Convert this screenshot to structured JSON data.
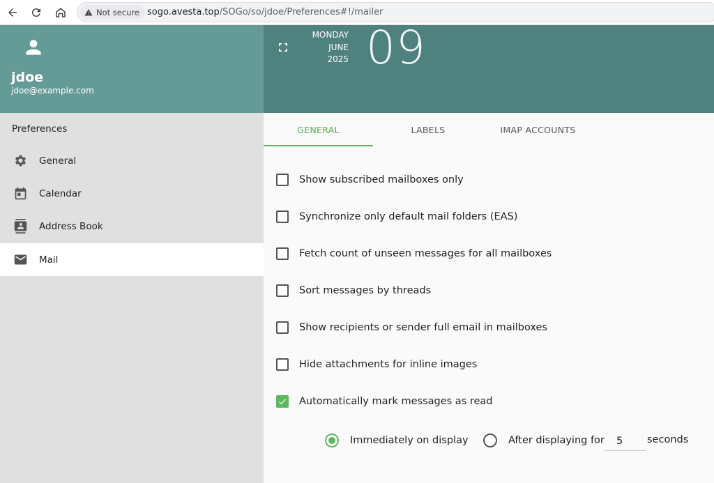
{
  "browser": {
    "security_label": "Not secure",
    "url_host": "sogo.avesta.top",
    "url_path": "/SOGo/so/jdoe/Preferences#!/mailer"
  },
  "user": {
    "name": "jdoe",
    "email": "jdoe@example.com"
  },
  "date": {
    "weekday": "MONDAY",
    "month": "JUNE",
    "year": "2025",
    "day": "09"
  },
  "sidebar": {
    "title": "Preferences",
    "items": [
      {
        "label": "General",
        "icon": "gear-icon"
      },
      {
        "label": "Calendar",
        "icon": "calendar-icon"
      },
      {
        "label": "Address Book",
        "icon": "address-book-icon"
      },
      {
        "label": "Mail",
        "icon": "mail-icon",
        "active": true
      }
    ]
  },
  "tabs": [
    {
      "label": "GENERAL",
      "active": true
    },
    {
      "label": "LABELS"
    },
    {
      "label": "IMAP ACCOUNTS"
    }
  ],
  "options": [
    {
      "label": "Show subscribed mailboxes only",
      "checked": false
    },
    {
      "label": "Synchronize only default mail folders (EAS)",
      "checked": false
    },
    {
      "label": "Fetch count of unseen messages for all mailboxes",
      "checked": false
    },
    {
      "label": "Sort messages by threads",
      "checked": false
    },
    {
      "label": "Show recipients or sender full email in mailboxes",
      "checked": false
    },
    {
      "label": "Hide attachments for inline images",
      "checked": false
    },
    {
      "label": "Automatically mark messages as read",
      "checked": true
    }
  ],
  "mark_read": {
    "immediately_label": "Immediately on display",
    "after_label": "After displaying for",
    "seconds_value": "5",
    "seconds_label": "seconds",
    "selected": "immediately"
  },
  "colors": {
    "sidebar_header": "#659b96",
    "top_header": "#4f817f",
    "accent": "#5cb85c"
  }
}
